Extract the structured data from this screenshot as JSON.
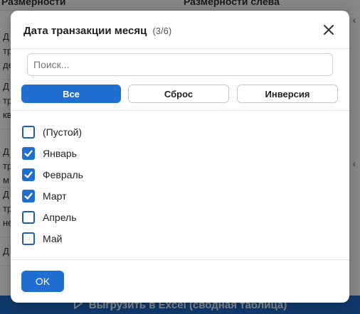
{
  "background": {
    "top_left_text": "Размерности",
    "top_right_text": "Размерности слева",
    "left_rows": [
      "Д тр де",
      "Д тр кв",
      "Д тр м",
      "Д тр не",
      "Д"
    ],
    "bottom_bar_label": "Выгрузить в Excel (сводная таблица)"
  },
  "modal": {
    "title": "Дата транзакции месяц",
    "count": "(3/6)",
    "search_placeholder": "Поиск...",
    "buttons": {
      "all": "Все",
      "reset": "Сброс",
      "invert": "Инверсия"
    },
    "options": [
      {
        "label": "(Пустой)",
        "checked": false
      },
      {
        "label": "Январь",
        "checked": true
      },
      {
        "label": "Февраль",
        "checked": true
      },
      {
        "label": "Март",
        "checked": true
      },
      {
        "label": "Апрель",
        "checked": false
      },
      {
        "label": "Май",
        "checked": false
      }
    ],
    "ok_label": "OK"
  },
  "colors": {
    "accent": "#1e6fd0",
    "bottom_bar": "#1e6bc5",
    "overlay": "rgba(0,0,0,0.45)"
  },
  "icons": {
    "close": "close-icon",
    "check": "check-icon",
    "play": "play-icon",
    "chevron": "chevron-left-icon"
  }
}
